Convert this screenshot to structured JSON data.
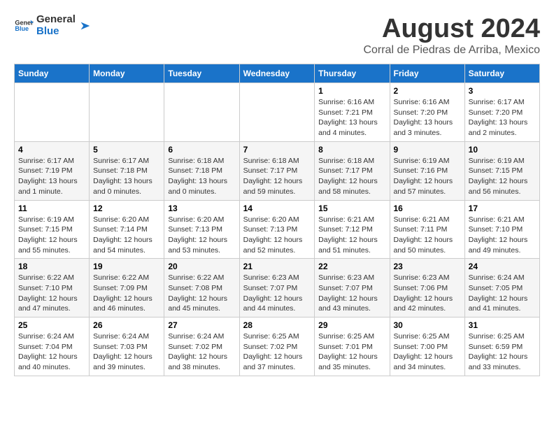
{
  "logo": {
    "general": "General",
    "blue": "Blue"
  },
  "title": {
    "month": "August 2024",
    "location": "Corral de Piedras de Arriba, Mexico"
  },
  "days_of_week": [
    "Sunday",
    "Monday",
    "Tuesday",
    "Wednesday",
    "Thursday",
    "Friday",
    "Saturday"
  ],
  "weeks": [
    [
      {
        "day": "",
        "info": ""
      },
      {
        "day": "",
        "info": ""
      },
      {
        "day": "",
        "info": ""
      },
      {
        "day": "",
        "info": ""
      },
      {
        "day": "1",
        "info": "Sunrise: 6:16 AM\nSunset: 7:21 PM\nDaylight: 13 hours\nand 4 minutes."
      },
      {
        "day": "2",
        "info": "Sunrise: 6:16 AM\nSunset: 7:20 PM\nDaylight: 13 hours\nand 3 minutes."
      },
      {
        "day": "3",
        "info": "Sunrise: 6:17 AM\nSunset: 7:20 PM\nDaylight: 13 hours\nand 2 minutes."
      }
    ],
    [
      {
        "day": "4",
        "info": "Sunrise: 6:17 AM\nSunset: 7:19 PM\nDaylight: 13 hours\nand 1 minute."
      },
      {
        "day": "5",
        "info": "Sunrise: 6:17 AM\nSunset: 7:18 PM\nDaylight: 13 hours\nand 0 minutes."
      },
      {
        "day": "6",
        "info": "Sunrise: 6:18 AM\nSunset: 7:18 PM\nDaylight: 13 hours\nand 0 minutes."
      },
      {
        "day": "7",
        "info": "Sunrise: 6:18 AM\nSunset: 7:17 PM\nDaylight: 12 hours\nand 59 minutes."
      },
      {
        "day": "8",
        "info": "Sunrise: 6:18 AM\nSunset: 7:17 PM\nDaylight: 12 hours\nand 58 minutes."
      },
      {
        "day": "9",
        "info": "Sunrise: 6:19 AM\nSunset: 7:16 PM\nDaylight: 12 hours\nand 57 minutes."
      },
      {
        "day": "10",
        "info": "Sunrise: 6:19 AM\nSunset: 7:15 PM\nDaylight: 12 hours\nand 56 minutes."
      }
    ],
    [
      {
        "day": "11",
        "info": "Sunrise: 6:19 AM\nSunset: 7:15 PM\nDaylight: 12 hours\nand 55 minutes."
      },
      {
        "day": "12",
        "info": "Sunrise: 6:20 AM\nSunset: 7:14 PM\nDaylight: 12 hours\nand 54 minutes."
      },
      {
        "day": "13",
        "info": "Sunrise: 6:20 AM\nSunset: 7:13 PM\nDaylight: 12 hours\nand 53 minutes."
      },
      {
        "day": "14",
        "info": "Sunrise: 6:20 AM\nSunset: 7:13 PM\nDaylight: 12 hours\nand 52 minutes."
      },
      {
        "day": "15",
        "info": "Sunrise: 6:21 AM\nSunset: 7:12 PM\nDaylight: 12 hours\nand 51 minutes."
      },
      {
        "day": "16",
        "info": "Sunrise: 6:21 AM\nSunset: 7:11 PM\nDaylight: 12 hours\nand 50 minutes."
      },
      {
        "day": "17",
        "info": "Sunrise: 6:21 AM\nSunset: 7:10 PM\nDaylight: 12 hours\nand 49 minutes."
      }
    ],
    [
      {
        "day": "18",
        "info": "Sunrise: 6:22 AM\nSunset: 7:10 PM\nDaylight: 12 hours\nand 47 minutes."
      },
      {
        "day": "19",
        "info": "Sunrise: 6:22 AM\nSunset: 7:09 PM\nDaylight: 12 hours\nand 46 minutes."
      },
      {
        "day": "20",
        "info": "Sunrise: 6:22 AM\nSunset: 7:08 PM\nDaylight: 12 hours\nand 45 minutes."
      },
      {
        "day": "21",
        "info": "Sunrise: 6:23 AM\nSunset: 7:07 PM\nDaylight: 12 hours\nand 44 minutes."
      },
      {
        "day": "22",
        "info": "Sunrise: 6:23 AM\nSunset: 7:07 PM\nDaylight: 12 hours\nand 43 minutes."
      },
      {
        "day": "23",
        "info": "Sunrise: 6:23 AM\nSunset: 7:06 PM\nDaylight: 12 hours\nand 42 minutes."
      },
      {
        "day": "24",
        "info": "Sunrise: 6:24 AM\nSunset: 7:05 PM\nDaylight: 12 hours\nand 41 minutes."
      }
    ],
    [
      {
        "day": "25",
        "info": "Sunrise: 6:24 AM\nSunset: 7:04 PM\nDaylight: 12 hours\nand 40 minutes."
      },
      {
        "day": "26",
        "info": "Sunrise: 6:24 AM\nSunset: 7:03 PM\nDaylight: 12 hours\nand 39 minutes."
      },
      {
        "day": "27",
        "info": "Sunrise: 6:24 AM\nSunset: 7:02 PM\nDaylight: 12 hours\nand 38 minutes."
      },
      {
        "day": "28",
        "info": "Sunrise: 6:25 AM\nSunset: 7:02 PM\nDaylight: 12 hours\nand 37 minutes."
      },
      {
        "day": "29",
        "info": "Sunrise: 6:25 AM\nSunset: 7:01 PM\nDaylight: 12 hours\nand 35 minutes."
      },
      {
        "day": "30",
        "info": "Sunrise: 6:25 AM\nSunset: 7:00 PM\nDaylight: 12 hours\nand 34 minutes."
      },
      {
        "day": "31",
        "info": "Sunrise: 6:25 AM\nSunset: 6:59 PM\nDaylight: 12 hours\nand 33 minutes."
      }
    ]
  ]
}
